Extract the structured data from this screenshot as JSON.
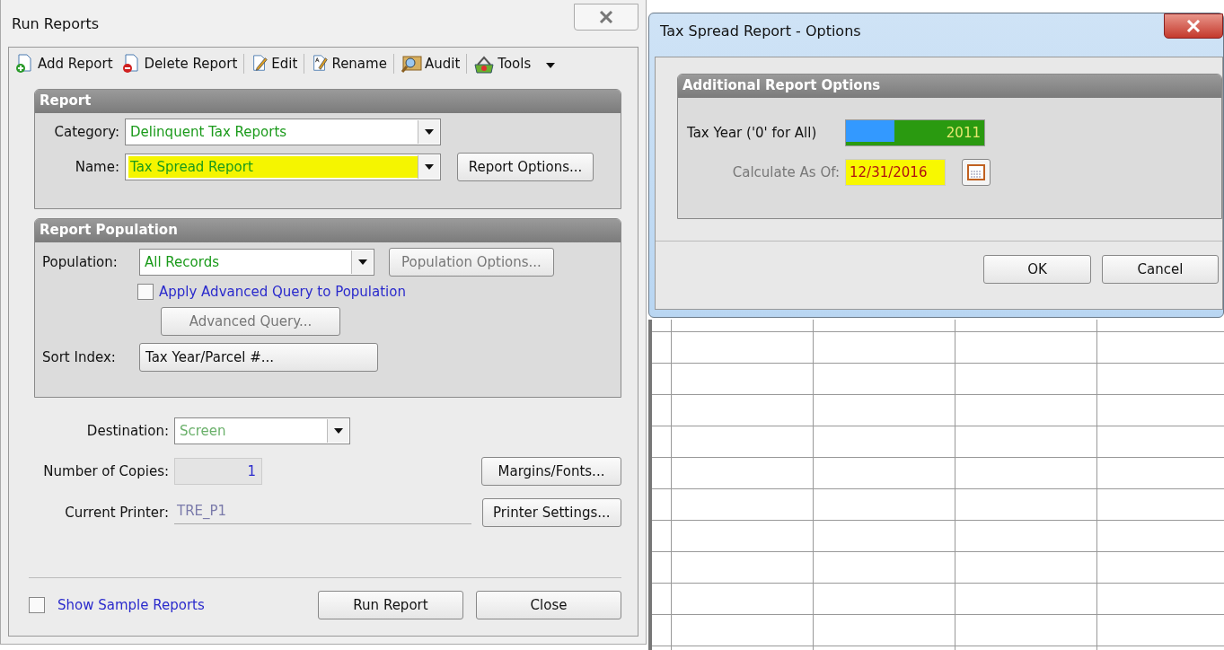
{
  "run_reports": {
    "title": "Run Reports",
    "toolbar": [
      {
        "label": "Add Report",
        "kind": "add"
      },
      {
        "label": "Delete Report",
        "kind": "delete"
      },
      {
        "label": "Edit",
        "kind": "edit"
      },
      {
        "label": "Rename",
        "kind": "rename"
      },
      {
        "label": "Audit",
        "kind": "audit"
      },
      {
        "label": "Tools",
        "kind": "tools"
      }
    ],
    "report_group": {
      "title": "Report",
      "category": {
        "label": "Category:",
        "value": "Delinquent Tax Reports",
        "highlighted": false
      },
      "name": {
        "label": "Name:",
        "value": "Tax Spread Report",
        "highlighted": true
      },
      "options_button": "Report Options..."
    },
    "population_group": {
      "title": "Report Population",
      "population": {
        "label": "Population:",
        "value": "All Records"
      },
      "population_options": {
        "label": "Population Options...",
        "disabled": true
      },
      "advanced_query_checkbox": {
        "label": "Apply Advanced Query to Population",
        "checked": false
      },
      "advanced_query_button": {
        "label": "Advanced Query...",
        "disabled": true
      },
      "sort_index": {
        "label": "Sort Index:",
        "value": "Tax Year/Parcel #..."
      }
    },
    "destination": {
      "label": "Destination:",
      "value": "Screen",
      "disabled": true
    },
    "copies": {
      "label": "Number of Copies:",
      "value": "1"
    },
    "printer": {
      "label": "Current Printer:",
      "value": "TRE_P1"
    },
    "side_buttons": [
      "Margins/Fonts...",
      "Printer Settings..."
    ],
    "show_sample": {
      "label": "Show Sample Reports",
      "checked": false
    },
    "footer_buttons": [
      "Run Report",
      "Close"
    ]
  },
  "options_dialog": {
    "title": "Tax Spread Report -  Options",
    "group_title": "Additional Report Options",
    "tax_year": {
      "label": "Tax Year ('0' for All)",
      "value": "2011",
      "selected": true,
      "highlighted": true
    },
    "calculate_as_of": {
      "label": "Calculate As Of:",
      "value": "12/31/2016",
      "highlighted": true
    },
    "buttons": [
      "OK",
      "Cancel"
    ]
  }
}
